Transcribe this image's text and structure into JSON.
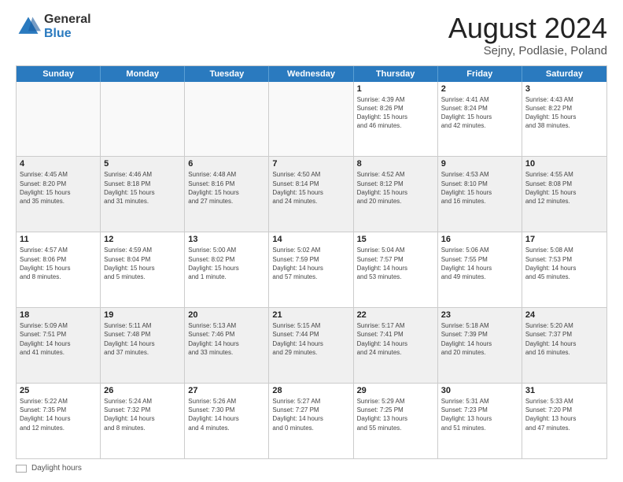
{
  "header": {
    "logo_general": "General",
    "logo_blue": "Blue",
    "title": "August 2024",
    "subtitle": "Sejny, Podlasie, Poland"
  },
  "calendar": {
    "days_of_week": [
      "Sunday",
      "Monday",
      "Tuesday",
      "Wednesday",
      "Thursday",
      "Friday",
      "Saturday"
    ],
    "weeks": [
      [
        {
          "day": "",
          "info": "",
          "empty": true
        },
        {
          "day": "",
          "info": "",
          "empty": true
        },
        {
          "day": "",
          "info": "",
          "empty": true
        },
        {
          "day": "",
          "info": "",
          "empty": true
        },
        {
          "day": "1",
          "info": "Sunrise: 4:39 AM\nSunset: 8:26 PM\nDaylight: 15 hours\nand 46 minutes."
        },
        {
          "day": "2",
          "info": "Sunrise: 4:41 AM\nSunset: 8:24 PM\nDaylight: 15 hours\nand 42 minutes."
        },
        {
          "day": "3",
          "info": "Sunrise: 4:43 AM\nSunset: 8:22 PM\nDaylight: 15 hours\nand 38 minutes."
        }
      ],
      [
        {
          "day": "4",
          "info": "Sunrise: 4:45 AM\nSunset: 8:20 PM\nDaylight: 15 hours\nand 35 minutes.",
          "shaded": true
        },
        {
          "day": "5",
          "info": "Sunrise: 4:46 AM\nSunset: 8:18 PM\nDaylight: 15 hours\nand 31 minutes.",
          "shaded": true
        },
        {
          "day": "6",
          "info": "Sunrise: 4:48 AM\nSunset: 8:16 PM\nDaylight: 15 hours\nand 27 minutes.",
          "shaded": true
        },
        {
          "day": "7",
          "info": "Sunrise: 4:50 AM\nSunset: 8:14 PM\nDaylight: 15 hours\nand 24 minutes.",
          "shaded": true
        },
        {
          "day": "8",
          "info": "Sunrise: 4:52 AM\nSunset: 8:12 PM\nDaylight: 15 hours\nand 20 minutes.",
          "shaded": true
        },
        {
          "day": "9",
          "info": "Sunrise: 4:53 AM\nSunset: 8:10 PM\nDaylight: 15 hours\nand 16 minutes.",
          "shaded": true
        },
        {
          "day": "10",
          "info": "Sunrise: 4:55 AM\nSunset: 8:08 PM\nDaylight: 15 hours\nand 12 minutes.",
          "shaded": true
        }
      ],
      [
        {
          "day": "11",
          "info": "Sunrise: 4:57 AM\nSunset: 8:06 PM\nDaylight: 15 hours\nand 8 minutes."
        },
        {
          "day": "12",
          "info": "Sunrise: 4:59 AM\nSunset: 8:04 PM\nDaylight: 15 hours\nand 5 minutes."
        },
        {
          "day": "13",
          "info": "Sunrise: 5:00 AM\nSunset: 8:02 PM\nDaylight: 15 hours\nand 1 minute."
        },
        {
          "day": "14",
          "info": "Sunrise: 5:02 AM\nSunset: 7:59 PM\nDaylight: 14 hours\nand 57 minutes."
        },
        {
          "day": "15",
          "info": "Sunrise: 5:04 AM\nSunset: 7:57 PM\nDaylight: 14 hours\nand 53 minutes."
        },
        {
          "day": "16",
          "info": "Sunrise: 5:06 AM\nSunset: 7:55 PM\nDaylight: 14 hours\nand 49 minutes."
        },
        {
          "day": "17",
          "info": "Sunrise: 5:08 AM\nSunset: 7:53 PM\nDaylight: 14 hours\nand 45 minutes."
        }
      ],
      [
        {
          "day": "18",
          "info": "Sunrise: 5:09 AM\nSunset: 7:51 PM\nDaylight: 14 hours\nand 41 minutes.",
          "shaded": true
        },
        {
          "day": "19",
          "info": "Sunrise: 5:11 AM\nSunset: 7:48 PM\nDaylight: 14 hours\nand 37 minutes.",
          "shaded": true
        },
        {
          "day": "20",
          "info": "Sunrise: 5:13 AM\nSunset: 7:46 PM\nDaylight: 14 hours\nand 33 minutes.",
          "shaded": true
        },
        {
          "day": "21",
          "info": "Sunrise: 5:15 AM\nSunset: 7:44 PM\nDaylight: 14 hours\nand 29 minutes.",
          "shaded": true
        },
        {
          "day": "22",
          "info": "Sunrise: 5:17 AM\nSunset: 7:41 PM\nDaylight: 14 hours\nand 24 minutes.",
          "shaded": true
        },
        {
          "day": "23",
          "info": "Sunrise: 5:18 AM\nSunset: 7:39 PM\nDaylight: 14 hours\nand 20 minutes.",
          "shaded": true
        },
        {
          "day": "24",
          "info": "Sunrise: 5:20 AM\nSunset: 7:37 PM\nDaylight: 14 hours\nand 16 minutes.",
          "shaded": true
        }
      ],
      [
        {
          "day": "25",
          "info": "Sunrise: 5:22 AM\nSunset: 7:35 PM\nDaylight: 14 hours\nand 12 minutes."
        },
        {
          "day": "26",
          "info": "Sunrise: 5:24 AM\nSunset: 7:32 PM\nDaylight: 14 hours\nand 8 minutes."
        },
        {
          "day": "27",
          "info": "Sunrise: 5:26 AM\nSunset: 7:30 PM\nDaylight: 14 hours\nand 4 minutes."
        },
        {
          "day": "28",
          "info": "Sunrise: 5:27 AM\nSunset: 7:27 PM\nDaylight: 14 hours\nand 0 minutes."
        },
        {
          "day": "29",
          "info": "Sunrise: 5:29 AM\nSunset: 7:25 PM\nDaylight: 13 hours\nand 55 minutes."
        },
        {
          "day": "30",
          "info": "Sunrise: 5:31 AM\nSunset: 7:23 PM\nDaylight: 13 hours\nand 51 minutes."
        },
        {
          "day": "31",
          "info": "Sunrise: 5:33 AM\nSunset: 7:20 PM\nDaylight: 13 hours\nand 47 minutes."
        }
      ]
    ],
    "footer_label": "Daylight hours"
  }
}
